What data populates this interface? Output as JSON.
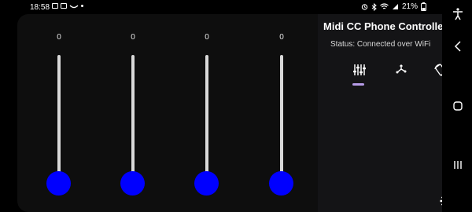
{
  "status_bar": {
    "time": "18:58",
    "battery_percent": "21%"
  },
  "sliders": [
    {
      "value": "0",
      "level": 0
    },
    {
      "value": "0",
      "level": 0
    },
    {
      "value": "0",
      "level": 0
    },
    {
      "value": "0",
      "level": 0
    }
  ],
  "panel": {
    "title": "Midi CC Phone Controller",
    "status": "Status: Connected over WiFi",
    "tabs": [
      {
        "icon": "sliders-icon",
        "selected": true
      },
      {
        "icon": "xy-pad-icon",
        "selected": false
      },
      {
        "icon": "gyro-icon",
        "selected": false
      }
    ],
    "accent_color": "#b79ce8"
  },
  "colors": {
    "thumb": "#0000ff",
    "track": "#d9d9d9",
    "background": "#0e0e0e"
  }
}
